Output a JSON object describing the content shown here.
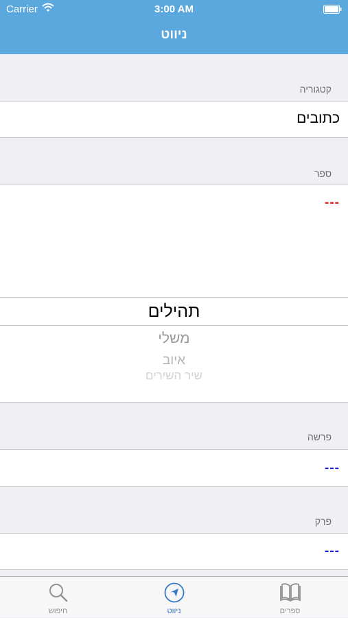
{
  "status_bar": {
    "carrier": "Carrier",
    "time": "3:00 AM"
  },
  "nav": {
    "title": "ניווט"
  },
  "category": {
    "header": "קטגוריה",
    "value": "כתובים"
  },
  "book": {
    "header": "ספר",
    "value": "---",
    "value_color": "#e0261e",
    "picker": {
      "selected": "תהילים",
      "items": [
        "משלי",
        "איוב",
        "שיר השירים"
      ]
    }
  },
  "parasha": {
    "header": "פרשה",
    "value": "---",
    "value_color": "#1f1fd6"
  },
  "chapter": {
    "header": "פרק",
    "value": "---",
    "value_color": "#1f1fd6"
  },
  "tabs": [
    {
      "label": "חיפוש",
      "icon": "search-icon"
    },
    {
      "label": "ניווט",
      "icon": "navigation-icon",
      "active": true
    },
    {
      "label": "ספרים",
      "icon": "book-icon"
    }
  ],
  "colors": {
    "accent": "#5aa8de",
    "tab_active": "#3478c6",
    "background": "#efeff4"
  }
}
